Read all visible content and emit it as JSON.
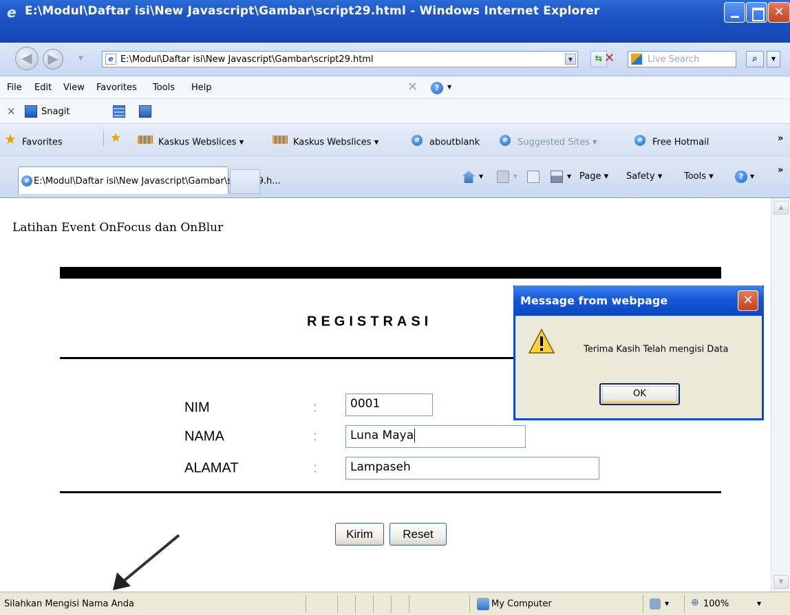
{
  "window": {
    "title": "E:\\Modul\\Daftar isi\\New Javascript\\Gambar\\script29.html - Windows Internet Explorer"
  },
  "address": {
    "url": "E:\\Modul\\Daftar isi\\New Javascript\\Gambar\\script29.html",
    "search_placeholder": "Live Search"
  },
  "menu": {
    "items": [
      "File",
      "Edit",
      "View",
      "Favorites",
      "Tools",
      "Help"
    ]
  },
  "snagit": {
    "label": "Snagit"
  },
  "favorites": {
    "label": "Favorites",
    "links": [
      {
        "label": "Kaskus Webslices ▾",
        "icon": "webslice-icon"
      },
      {
        "label": "Kaskus Webslices ▾",
        "icon": "webslice-icon"
      },
      {
        "label": "aboutblank",
        "icon": "ie-page-icon"
      },
      {
        "label": "Suggested Sites ▾",
        "icon": "ie-page-icon"
      },
      {
        "label": "Free Hotmail",
        "icon": "ie-page-icon"
      }
    ],
    "more": "»"
  },
  "tabs": {
    "active_label": "E:\\Modul\\Daftar isi\\New Javascript\\Gambar\\script29.h...",
    "commands": {
      "page": "Page ▾",
      "safety": "Safety ▾",
      "tools": "Tools ▾"
    },
    "more": "»"
  },
  "page": {
    "heading": "Latihan Event OnFocus dan OnBlur",
    "form_title": "REGISTRASI",
    "fields": [
      {
        "label": "NIM",
        "colon": ":",
        "value": "0001"
      },
      {
        "label": "NAMA",
        "colon": ":",
        "value": "Luna Maya"
      },
      {
        "label": "ALAMAT",
        "colon": ":",
        "value": "Lampaseh"
      }
    ],
    "buttons": {
      "submit": "Kirim",
      "reset": "Reset"
    }
  },
  "dialog": {
    "title": "Message from webpage",
    "message": "Terima Kasih Telah mengisi Data",
    "ok": "OK",
    "icon": "warning-icon"
  },
  "status": {
    "text": "Silahkan Mengisi Nama Anda",
    "zone": "My Computer",
    "zoom": "100%"
  },
  "colors": {
    "titlebar": "#1c52c4",
    "dialog_border": "#0a4ecf",
    "close_button": "#c4411f"
  }
}
